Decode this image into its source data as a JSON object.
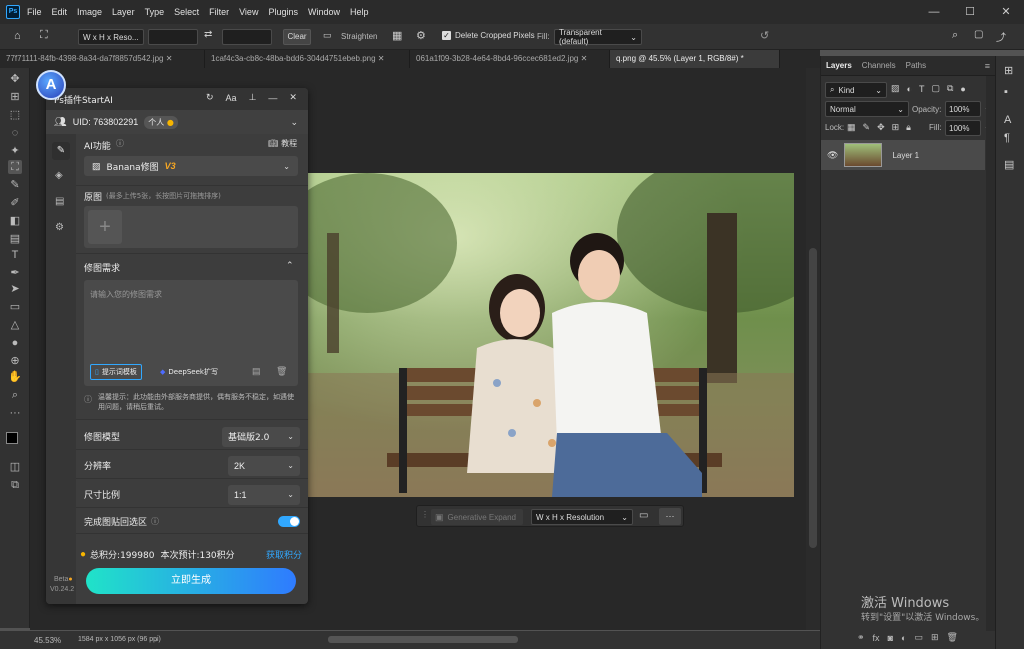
{
  "menubar": {
    "logo": "Ps",
    "items": [
      "File",
      "Edit",
      "Image",
      "Layer",
      "Type",
      "Select",
      "Filter",
      "View",
      "Plugins",
      "Window",
      "Help"
    ],
    "window_controls": [
      "—",
      "☐",
      "✕"
    ]
  },
  "options_bar": {
    "ratio_select": "W x H x Reso...",
    "clear_label": "Clear",
    "straighten_label": "Straighten",
    "delete_cropped_label": "Delete Cropped Pixels",
    "delete_cropped_checked": true,
    "fill_label": "Fill:",
    "fill_value": "Transparent (default)"
  },
  "tabs": [
    {
      "label": "77f71111-84fb-4398-8a34-da7f8857d542.jpg",
      "active": false
    },
    {
      "label": "1caf4c3a-cb8c-48ba-bdd6-304d4751ebeb.png",
      "active": false
    },
    {
      "label": "061a1f09-3b28-4e64-8bd4-96ccec681ed2.jpg",
      "active": false
    },
    {
      "label": "q.png @ 45.5% (Layer 1, RGB/8#) *",
      "active": true
    }
  ],
  "context_bar": {
    "generative_expand": "Generative Expand",
    "resolution_select": "W x H x Resolution",
    "more": "···"
  },
  "status_bar": {
    "zoom": "45.53%",
    "doc_info": "1584 px x 1056 px (96 ppi)"
  },
  "layers_panel": {
    "tabs": [
      "Layers",
      "Channels",
      "Paths"
    ],
    "kind_label": "Kind",
    "blend_mode": "Normal",
    "opacity_label": "Opacity:",
    "opacity_value": "100%",
    "lock_label": "Lock:",
    "fill_label": "Fill:",
    "fill_value": "100%",
    "layer_name": "Layer 1"
  },
  "plugin": {
    "title": "Ps插件StartAI",
    "title_actions": [
      "↻",
      "Aa",
      "⊥",
      "—",
      "✕"
    ],
    "uid_label": "UID: 763802291",
    "user_badge": "个人",
    "ai_function_label": "AI功能",
    "tutorial_label": "教程",
    "model_select": "Banana修图",
    "model_version": "V3",
    "source_label": "原图",
    "source_hint": "(最多上传5张，长按图片可拖拽排序)",
    "edit_request_label": "修图需求",
    "edit_placeholder": "请输入您的修图需求",
    "prompt_template_btn": "提示词模板",
    "deepseek_btn": "DeepSeek扩写",
    "notice": "温馨提示：此功能由外部服务商提供，偶有服务不稳定，如遇使用问题，请稍后重试。",
    "edit_model_label": "修图模型",
    "edit_model_value": "基础版2.0",
    "resolution_label": "分辨率",
    "resolution_value": "2K",
    "ratio_label": "尺寸比例",
    "ratio_value": "1:1",
    "paste_back_label": "完成图贴回选区",
    "paste_back_on": true,
    "total_points": "总积分:199980",
    "estimate": "本次预计:130积分",
    "get_points": "获取积分",
    "generate_btn": "立即生成",
    "beta": "Beta",
    "version": "V0.24.2"
  },
  "watermark": {
    "line1": "激活 Windows",
    "line2": "转到\"设置\"以激活 Windows。"
  },
  "colors": {
    "accent": "#31a8ff",
    "generate_gradient_start": "#20e3c8",
    "generate_gradient_end": "#2f7bff",
    "coin": "#f7b500",
    "version_badge": "#f5a623"
  }
}
